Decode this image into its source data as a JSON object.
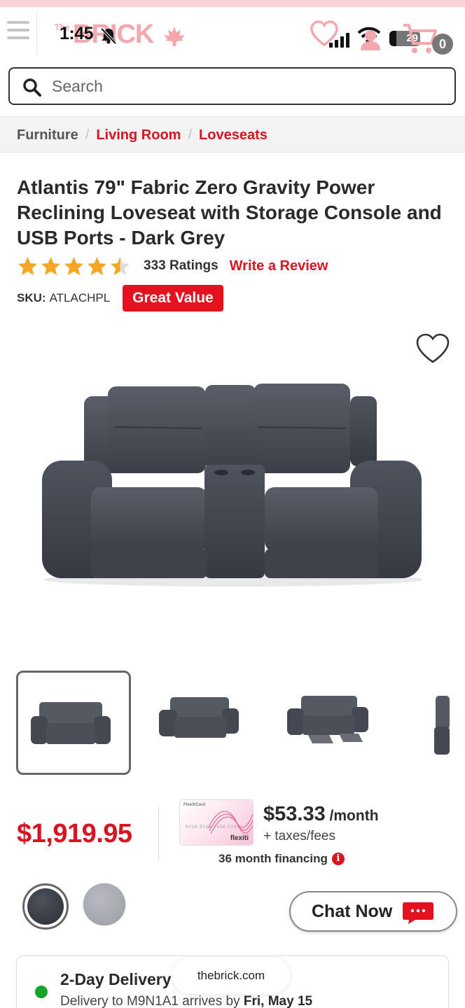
{
  "status_bar": {
    "time": "1:45",
    "battery": "29"
  },
  "header": {
    "logo_prefix": "The",
    "logo_text": "BRICK",
    "cart_count": "0"
  },
  "search": {
    "placeholder": "Search"
  },
  "breadcrumb": [
    "Furniture",
    "Living Room",
    "Loveseats"
  ],
  "product": {
    "title": "Atlantis 79\" Fabric Zero Gravity Power Reclining Loveseat with Storage Console and USB Ports - Dark Grey",
    "rating": 4.5,
    "rating_max": 5,
    "ratings_count": "333 Ratings",
    "write_review": "Write a Review",
    "sku_label": "SKU:",
    "sku": "ATLACHPL",
    "badge": "Great Value"
  },
  "pricing": {
    "price": "$1,919.95",
    "card_name": "FlexitiCard",
    "card_brand": "flexiti",
    "card_number": "9016 3219 1456 1269",
    "monthly_amount": "$53.33",
    "monthly_per": " /month",
    "taxes": "+ taxes/fees",
    "financing": "36 month financing"
  },
  "chat": {
    "label": "Chat Now"
  },
  "delivery": {
    "title": "2-Day Delivery",
    "subtitle_prefix": "Delivery to M9N1A1 arrives by ",
    "date": "Fri, May 15"
  },
  "browser": {
    "url": "thebrick.com"
  },
  "colors": {
    "brand_red": "#d7141f",
    "star": "#f5a623",
    "delivery_green": "#16a329"
  }
}
